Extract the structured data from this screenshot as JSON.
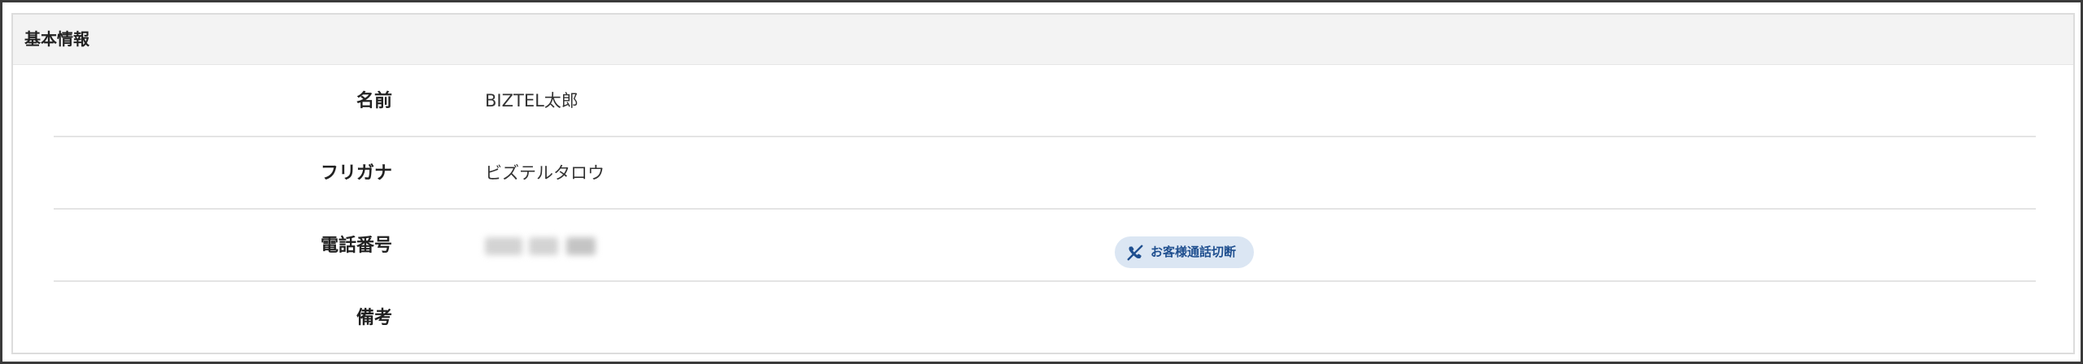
{
  "section": {
    "title": "基本情報"
  },
  "fields": {
    "name": {
      "label": "名前",
      "value": "BIZTEL太郎"
    },
    "furigana": {
      "label": "フリガナ",
      "value": "ビズテルタロウ"
    },
    "phone": {
      "label": "電話番号",
      "value_redacted": true
    },
    "notes": {
      "label": "備考",
      "value": ""
    }
  },
  "actions": {
    "hangup_label": "お客様通話切断",
    "hangup_icon": "phone-hangup-icon"
  },
  "colors": {
    "header_bg": "#f3f3f3",
    "button_bg": "#dbe6f3",
    "button_text": "#1f4f8f"
  }
}
